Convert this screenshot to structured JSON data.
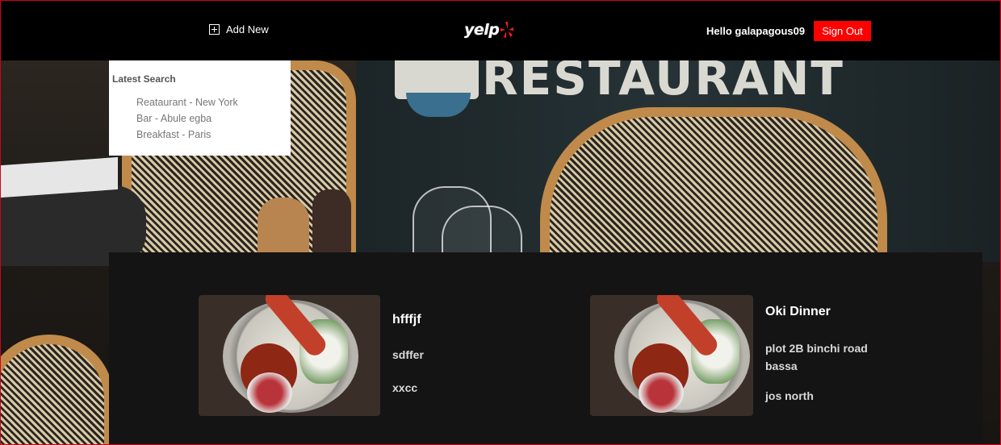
{
  "navbar": {
    "add_new_label": "Add New",
    "logo_text": "yelp",
    "greeting": "Hello galapagous09",
    "sign_out_label": "Sign Out"
  },
  "hero": {
    "sign_text": "RESTAURANT"
  },
  "latest_search": {
    "title": "Latest Search",
    "items": [
      "Reataurant - New York",
      "Bar - Abule egba",
      "Breakfast - Paris"
    ]
  },
  "results": [
    {
      "name": "hfffjf",
      "address": "sdffer",
      "city": "xxcc"
    },
    {
      "name": "Oki Dinner",
      "address": "plot 2B binchi road bassa",
      "city": "jos north"
    }
  ],
  "colors": {
    "brand_red": "#ff0000",
    "navbar_bg": "#000000",
    "panel_bg": "#151415"
  }
}
